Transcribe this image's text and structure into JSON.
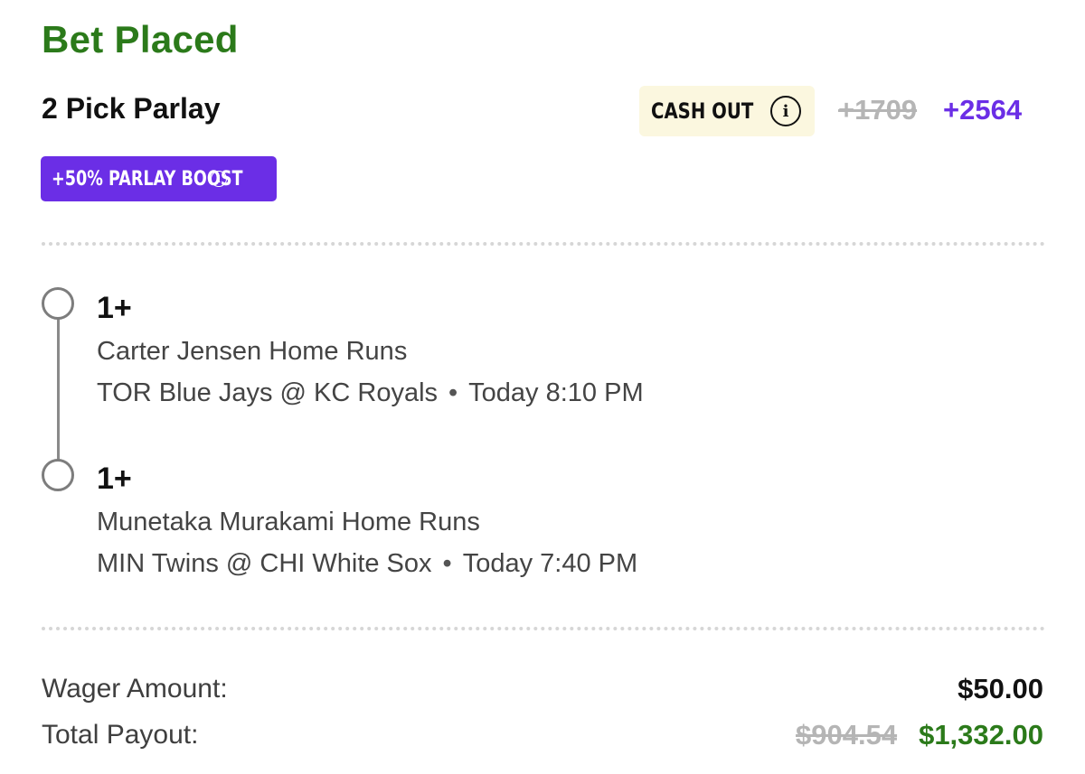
{
  "header": {
    "title": "Bet Placed",
    "bet_type": "2 Pick Parlay",
    "cash_out_label": "CASH OUT",
    "info_glyph": "i",
    "odds_original": "+1709",
    "odds_boosted": "+2564",
    "boost_label": "+50% PARLAY BOOST"
  },
  "legs": [
    {
      "value": "1+",
      "market": "Carter Jensen Home Runs",
      "matchup": "TOR Blue Jays @ KC Royals",
      "separator": "•",
      "time": "Today 8:10 PM"
    },
    {
      "value": "1+",
      "market": "Munetaka Murakami Home Runs",
      "matchup": "MIN Twins @ CHI White Sox",
      "separator": "•",
      "time": "Today 7:40 PM"
    }
  ],
  "summary": {
    "wager_label": "Wager Amount:",
    "wager_value": "$50.00",
    "payout_label": "Total Payout:",
    "payout_original": "$904.54",
    "payout_boosted": "$1,332.00"
  },
  "colors": {
    "title_green": "#2b7a1a",
    "boost_purple": "#6b2ee6",
    "cashout_bg": "#fbf7df",
    "struck_gray": "#b5b5b5"
  }
}
